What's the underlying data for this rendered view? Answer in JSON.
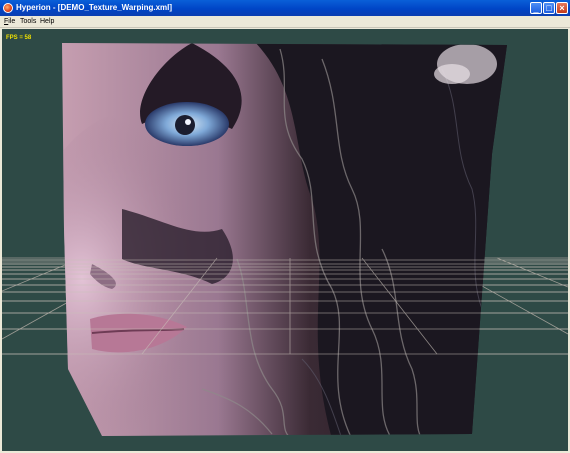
{
  "window": {
    "title": "Hyperion - [DEMO_Texture_Warping.xml]"
  },
  "title_buttons": {
    "minimize": "_",
    "maximize": "□",
    "close": "×"
  },
  "menu": {
    "items": [
      {
        "label": "File",
        "accel": "F",
        "rest": "ile"
      },
      {
        "label": "Tools",
        "accel": "",
        "rest": "Tools"
      },
      {
        "label": "Help",
        "accel": "",
        "rest": "Help"
      }
    ]
  },
  "viewport": {
    "fps": "FPS = 58",
    "background": "#2e4a46",
    "grid_color": "#b8b0a8"
  }
}
